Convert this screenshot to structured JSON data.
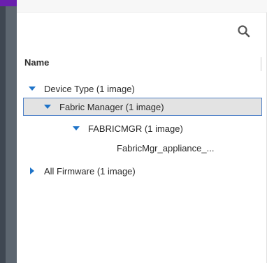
{
  "tree": {
    "column_header": "Name",
    "rows": [
      {
        "label": "Device Type (1 image)",
        "expanded": true
      },
      {
        "label": "Fabric Manager (1 image)",
        "expanded": true,
        "selected": true
      },
      {
        "label": "FABRICMGR (1 image)",
        "expanded": true
      },
      {
        "label": "FabricMgr_appliance_..."
      },
      {
        "label": "All Firmware (1 image)",
        "expanded": false
      }
    ]
  },
  "icons": {
    "search": "search-icon",
    "expanded": "caret-down-icon",
    "collapsed": "caret-right-icon"
  },
  "colors": {
    "accent": "#6a1fae",
    "rail": "#3f4752",
    "caret": "#1e73c8",
    "selection_border": "#4f81c7",
    "selection_fill": "#e3e3e3"
  }
}
